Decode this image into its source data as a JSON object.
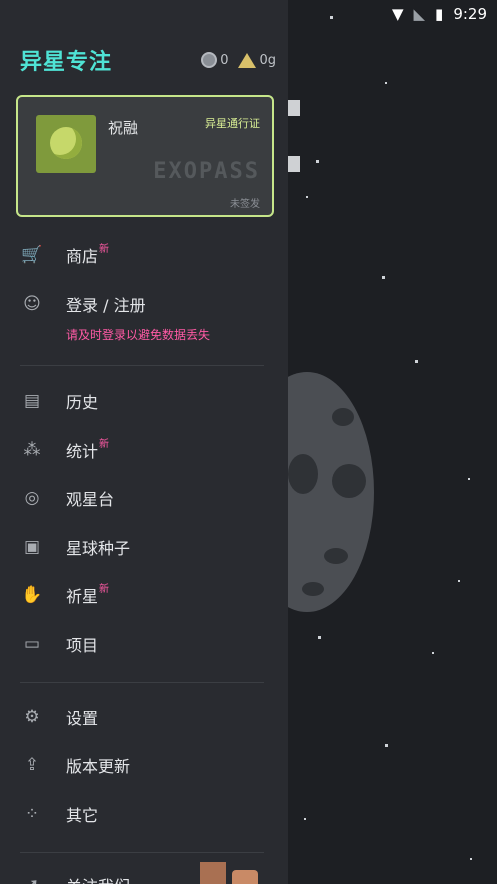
{
  "status": {
    "time": "9:29"
  },
  "header": {
    "title": "异星专注",
    "coins": "0",
    "gold": "0g"
  },
  "pass": {
    "user": "祝融",
    "title": "异星通行证",
    "brand": "EXOPASS",
    "status": "未签发"
  },
  "menu": {
    "shop": {
      "label": "商店",
      "badge": "新"
    },
    "login": {
      "label": "登录 / 注册",
      "warning": "请及时登录以避免数据丢失"
    },
    "history": {
      "label": "历史"
    },
    "stats": {
      "label": "统计",
      "badge": "新"
    },
    "observatory": {
      "label": "观星台"
    },
    "planet_seed": {
      "label": "星球种子"
    },
    "wish": {
      "label": "祈星",
      "badge": "新"
    },
    "projects": {
      "label": "项目"
    },
    "settings": {
      "label": "设置"
    },
    "update": {
      "label": "版本更新"
    },
    "other": {
      "label": "其它"
    },
    "about": {
      "label": "关注我们"
    }
  }
}
